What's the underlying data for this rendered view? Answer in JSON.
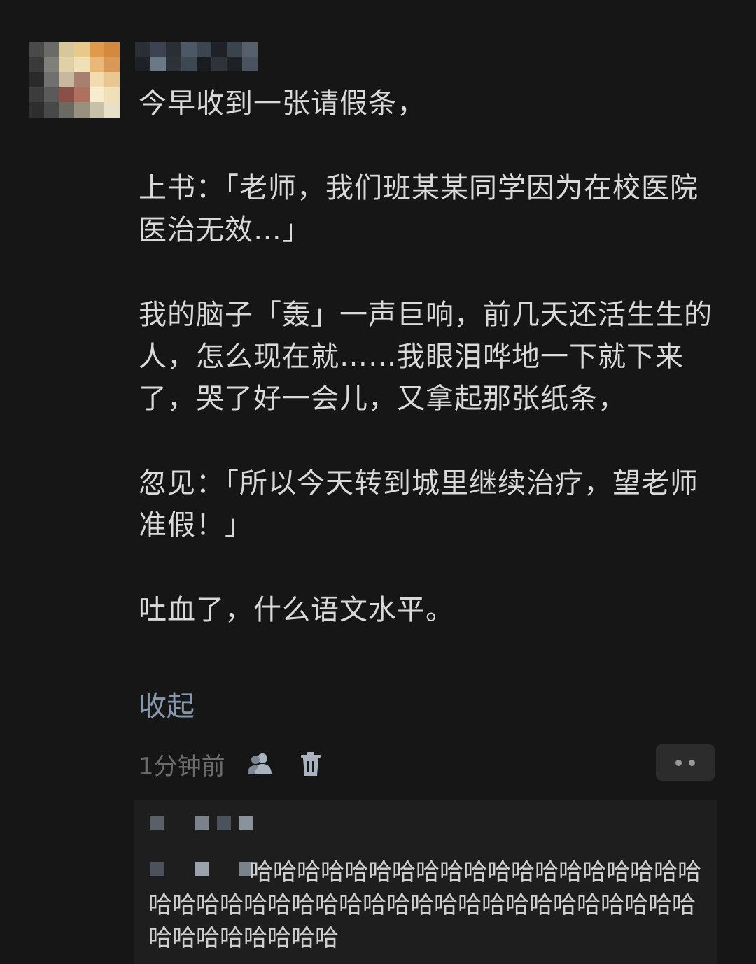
{
  "post": {
    "avatar_icon": "avatar-icon",
    "username_icon": "pixelated-username",
    "paragraphs": [
      "今早收到一张请假条，",
      "上书：「老师，我们班某某同学因为在校医院医治无效…」",
      "我的脑子「轰」一声巨响，前几天还活生生的人，怎么现在就……我眼泪哗地一下就下来了，哭了好一会儿，又拿起那张纸条，",
      "忽见：「所以今天转到城里继续治疗，望老师准假！」",
      "吐血了，什么语文水平。"
    ],
    "collapse_label": "收起",
    "timestamp": "1分钟前",
    "icons": {
      "visibility": "friends-visibility-icon",
      "delete": "trash-icon",
      "more": "more-options-icon"
    }
  },
  "comments": [
    {
      "author_icon": "pixelated-username",
      "text": "哈哈哈哈哈哈哈哈哈哈哈哈哈哈哈哈哈哈哈哈哈哈哈哈哈哈哈哈哈哈哈哈哈哈哈哈哈哈哈哈哈哈哈哈哈哈哈哈哈哈"
    }
  ],
  "colors": {
    "background": "#161616",
    "text": "#d9d9d9",
    "link": "#8598ad",
    "muted": "#6b6b6b",
    "comment_bg": "#1e1e1e"
  }
}
